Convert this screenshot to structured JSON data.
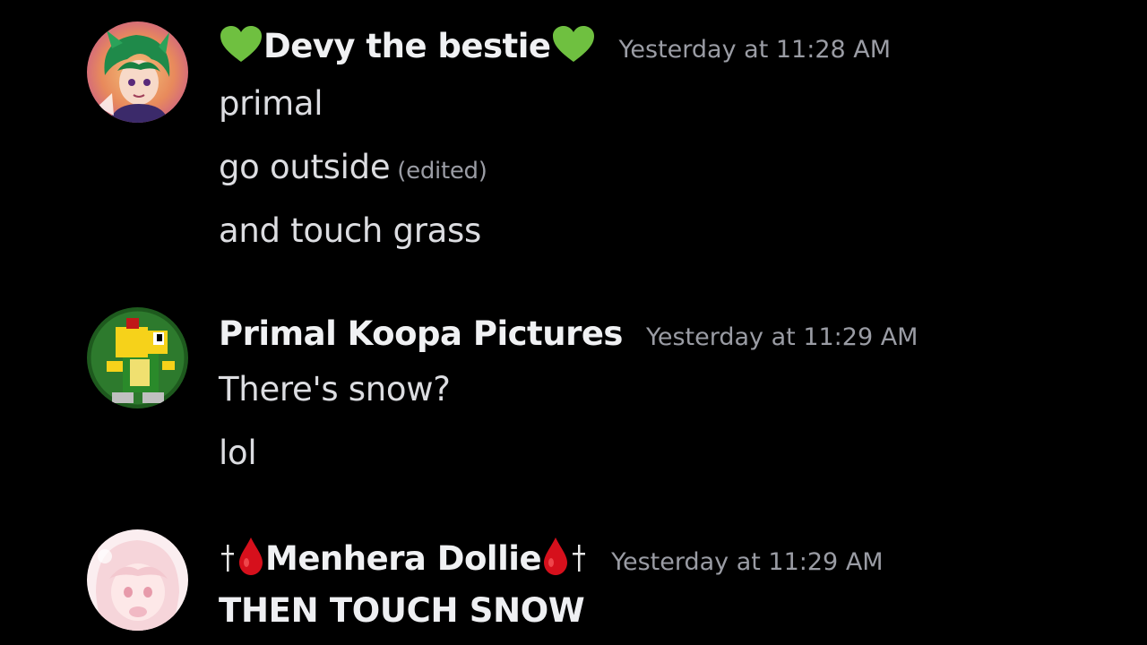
{
  "messages": [
    {
      "username": "Devy the bestie",
      "timestamp": "Yesterday at 11:28 AM",
      "avatar": "avatar-green-hair-character",
      "lines": [
        "primal",
        "go outside",
        "and touch grass"
      ],
      "edited_label": "(edited)"
    },
    {
      "username": "Primal Koopa Pictures",
      "timestamp": "Yesterday at 11:29 AM",
      "avatar": "avatar-pixel-koopa",
      "lines": [
        "There's snow?",
        "lol"
      ]
    },
    {
      "username": "Menhera Dollie",
      "timestamp": "Yesterday at 11:29 AM",
      "avatar": "avatar-pink-anime-girl",
      "lines": [
        "THEN TOUCH SNOW"
      ]
    }
  ],
  "colors": {
    "background": "#000000",
    "username": "#f0f1f3",
    "timestamp": "#9a9ca4",
    "text": "#dcdde1",
    "heart": "#6fc040",
    "blood": "#d6101c"
  }
}
